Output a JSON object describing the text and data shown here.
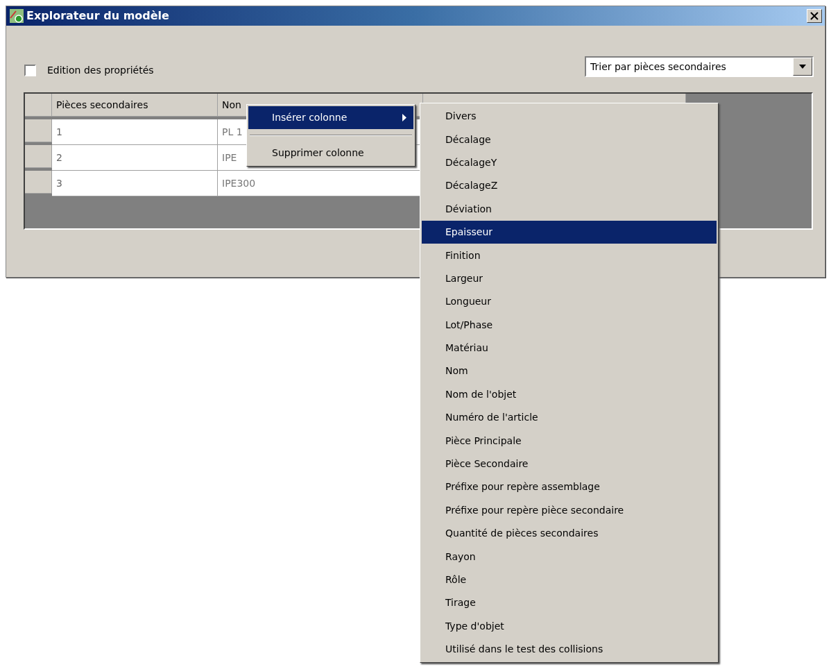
{
  "window": {
    "title": "Explorateur du modèle"
  },
  "edit_properties": {
    "label": "Edition des propriétés",
    "checked": false
  },
  "sort_select": {
    "value": "Trier par pièces secondaires"
  },
  "grid": {
    "columns": [
      "Pièces secondaires",
      "Non"
    ],
    "rows": [
      [
        "1",
        "PL 1"
      ],
      [
        "2",
        "IPE"
      ],
      [
        "3",
        "IPE300"
      ]
    ]
  },
  "context_menu": {
    "items": [
      {
        "label": "Insérer colonne",
        "selected": true,
        "has_submenu": true
      },
      {
        "label": "Supprimer colonne",
        "selected": false,
        "has_submenu": false
      }
    ]
  },
  "submenu": {
    "items": [
      {
        "label": "Divers",
        "selected": false
      },
      {
        "label": "Décalage",
        "selected": false
      },
      {
        "label": "DécalageY",
        "selected": false
      },
      {
        "label": "DécalageZ",
        "selected": false
      },
      {
        "label": "Déviation",
        "selected": false
      },
      {
        "label": "Epaisseur",
        "selected": true
      },
      {
        "label": "Finition",
        "selected": false
      },
      {
        "label": "Largeur",
        "selected": false
      },
      {
        "label": "Longueur",
        "selected": false
      },
      {
        "label": "Lot/Phase",
        "selected": false
      },
      {
        "label": "Matériau",
        "selected": false
      },
      {
        "label": "Nom",
        "selected": false
      },
      {
        "label": "Nom de l'objet",
        "selected": false
      },
      {
        "label": "Numéro de l'article",
        "selected": false
      },
      {
        "label": "Pièce Principale",
        "selected": false
      },
      {
        "label": "Pièce Secondaire",
        "selected": false
      },
      {
        "label": "Préfixe pour repère assemblage",
        "selected": false
      },
      {
        "label": "Préfixe pour repère pièce secondaire",
        "selected": false
      },
      {
        "label": "Quantité de pièces secondaires",
        "selected": false
      },
      {
        "label": "Rayon",
        "selected": false
      },
      {
        "label": "Rôle",
        "selected": false
      },
      {
        "label": "Tirage",
        "selected": false
      },
      {
        "label": "Type d'objet",
        "selected": false
      },
      {
        "label": "Utilisé dans le test des collisions",
        "selected": false
      }
    ]
  }
}
